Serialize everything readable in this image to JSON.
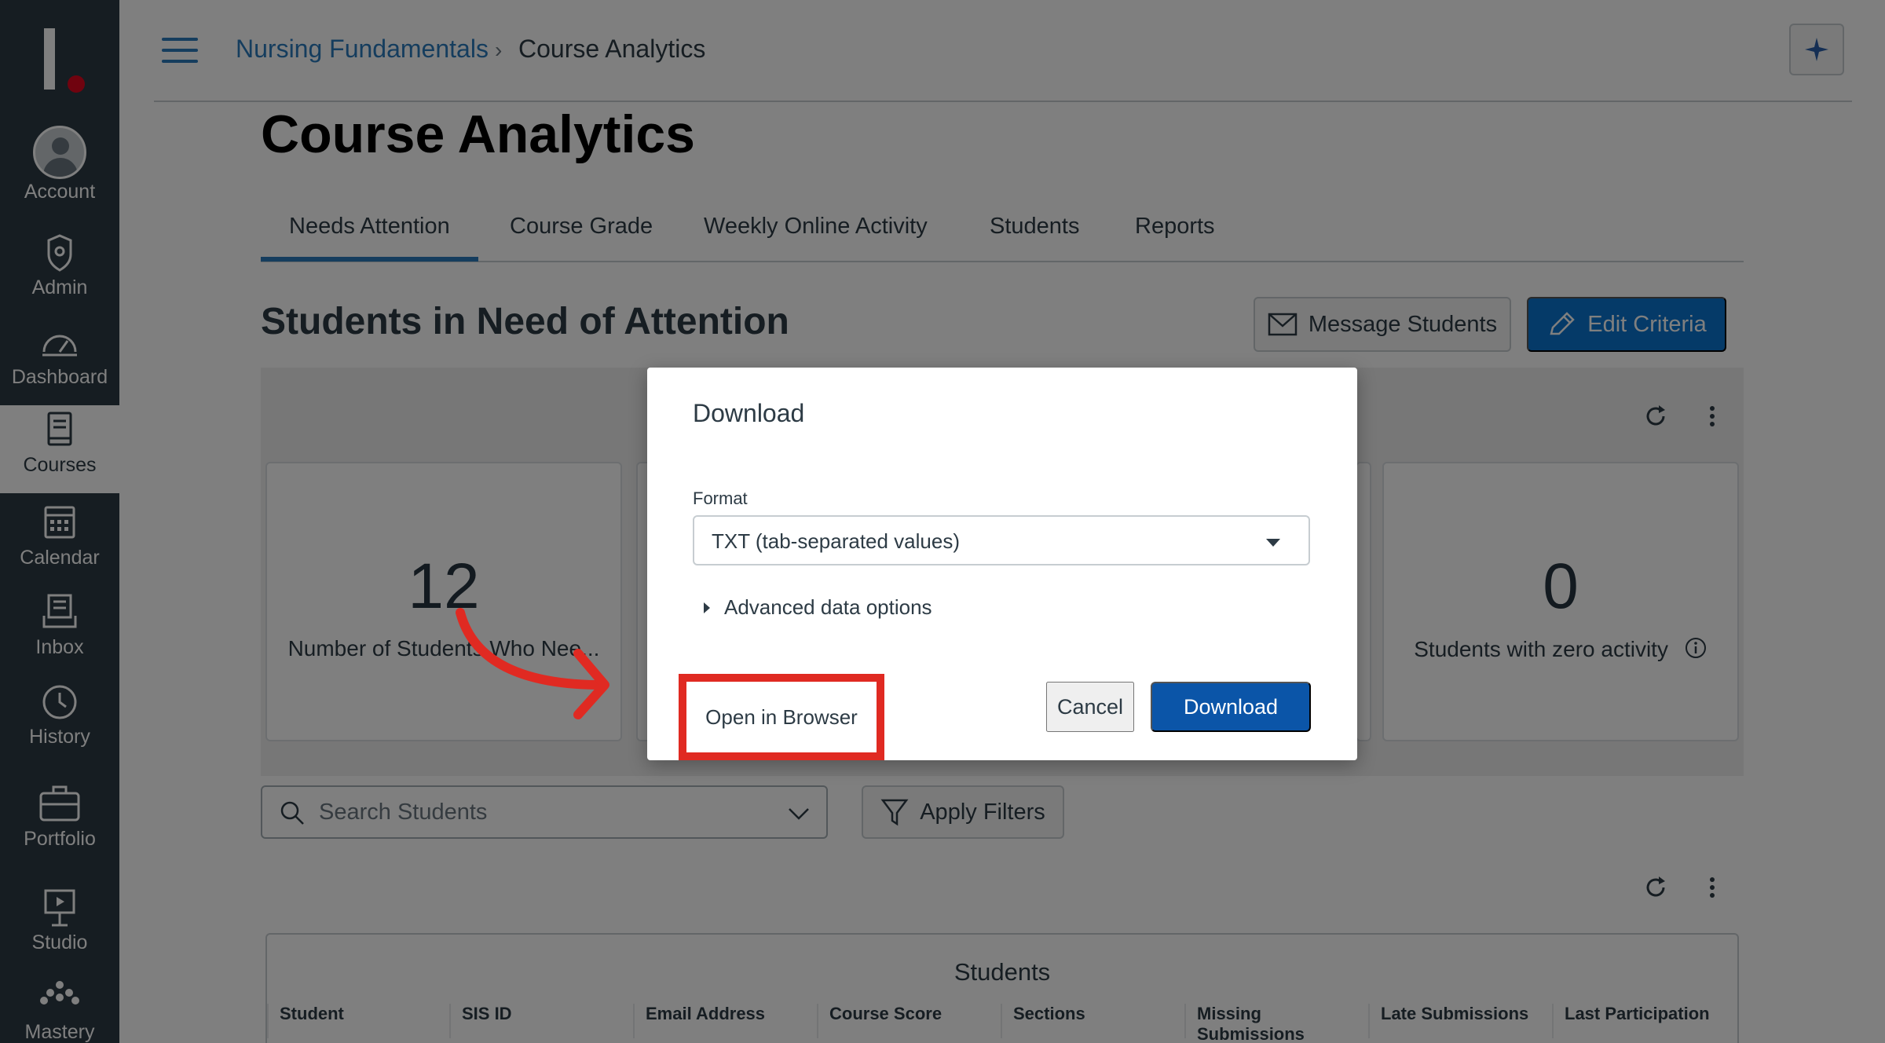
{
  "nav": {
    "items": [
      {
        "label": "Account",
        "icon": "account-avatar-icon"
      },
      {
        "label": "Admin",
        "icon": "admin-shield-icon"
      },
      {
        "label": "Dashboard",
        "icon": "dashboard-gauge-icon"
      },
      {
        "label": "Courses",
        "icon": "courses-book-icon"
      },
      {
        "label": "Calendar",
        "icon": "calendar-icon"
      },
      {
        "label": "Inbox",
        "icon": "inbox-icon"
      },
      {
        "label": "History",
        "icon": "history-clock-icon"
      },
      {
        "label": "Portfolio",
        "icon": "portfolio-briefcase-icon"
      },
      {
        "label": "Studio",
        "icon": "studio-easel-icon"
      },
      {
        "label": "Mastery",
        "icon": "mastery-dots-icon"
      }
    ],
    "active": "Courses"
  },
  "header": {
    "breadcrumb_course": "Nursing Fundamentals",
    "breadcrumb_sep": "›",
    "breadcrumb_current": "Course Analytics"
  },
  "page": {
    "title": "Course Analytics",
    "tabs": [
      "Needs Attention",
      "Course Grade",
      "Weekly Online Activity",
      "Students",
      "Reports"
    ],
    "active_tab": "Needs Attention",
    "section_title": "Students in Need of Attention",
    "message_button": "Message Students",
    "edit_button": "Edit Criteria"
  },
  "stats": {
    "card1": {
      "value": "12",
      "label": "Number of Students Who Nee..."
    },
    "card2": {
      "value": "0",
      "label": "Students with zero activity"
    }
  },
  "filters": {
    "search_placeholder": "Search Students",
    "apply_button": "Apply Filters"
  },
  "table": {
    "caption": "Students",
    "columns": [
      "Student",
      "SIS ID",
      "Email Address",
      "Course Score",
      "Sections",
      "Missing Submissions",
      "Late Submissions",
      "Last Participation"
    ]
  },
  "modal": {
    "title": "Download",
    "format_label": "Format",
    "format_value": "TXT (tab-separated values)",
    "advanced_label": "Advanced data options",
    "open_button": "Open in Browser",
    "cancel_button": "Cancel",
    "download_button": "Download"
  },
  "colors": {
    "nav_bg": "#2d3b45",
    "link": "#2b7abc",
    "primary": "#0b55a8",
    "highlight": "#e02a22",
    "logo_dot": "#e0061f"
  }
}
